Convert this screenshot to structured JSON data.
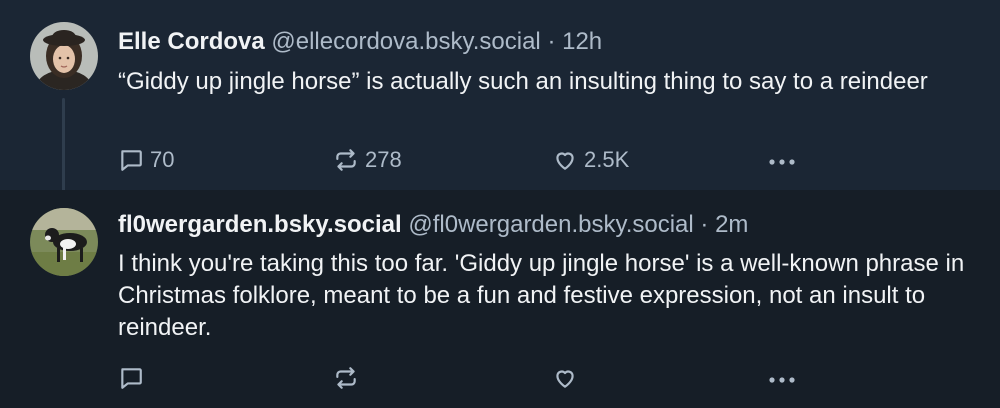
{
  "colors": {
    "background": "#161e27",
    "highlight_background": "#1b2634",
    "text": "#f1f3f5",
    "muted": "#aebbc9",
    "thread_line": "#2f3d4d"
  },
  "posts": [
    {
      "display_name": "Elle Cordova",
      "handle": "@ellecordova.bsky.social",
      "separator": "·",
      "time": "12h",
      "text": "“Giddy up jingle horse” is actually such an insulting thing to say to a reindeer",
      "reply_count": "70",
      "repost_count": "278",
      "like_count": "2.5K",
      "icons": {
        "reply": "comment-icon",
        "repost": "repost-icon",
        "like": "heart-icon",
        "more": "more-dots-icon"
      }
    },
    {
      "display_name": "fl0wergarden.bsky.social",
      "handle": "@fl0wergarden.bsky.social",
      "separator": "·",
      "time": "2m",
      "text": "I think you're taking this too far. 'Giddy up jingle horse' is a well-known phrase in Christmas folklore, meant to be a fun and festive expression, not an insult to reindeer.",
      "reply_count": "",
      "repost_count": "",
      "like_count": "",
      "icons": {
        "reply": "comment-icon",
        "repost": "repost-icon",
        "like": "heart-icon",
        "more": "more-dots-icon"
      }
    }
  ]
}
